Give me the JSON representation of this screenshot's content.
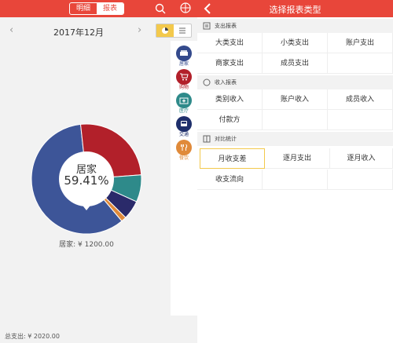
{
  "left": {
    "tabs": [
      {
        "label": "明细",
        "selected": false
      },
      {
        "label": "报表",
        "selected": true
      }
    ],
    "month": "2017年12月",
    "categories": [
      {
        "label": "居家",
        "color": "#344a8c",
        "icon": "sofa-icon"
      },
      {
        "label": "购物",
        "color": "#b2202a",
        "icon": "cart-icon"
      },
      {
        "label": "医疗",
        "color": "#2e8a8a",
        "icon": "medical-icon"
      },
      {
        "label": "交通",
        "color": "#1e2f6b",
        "icon": "bus-icon"
      },
      {
        "label": "餐饮",
        "color": "#e08a3a",
        "icon": "food-icon"
      }
    ],
    "pie_center": {
      "name": "居家",
      "percent": "59.41%"
    },
    "selected_amount": "居家: ¥ 1200.00",
    "total": "总支出: ¥ 2020.00"
  },
  "chart_data": {
    "type": "pie",
    "series": [
      {
        "name": "居家",
        "value": 59.41,
        "color": "#3d5598"
      },
      {
        "name": "购物",
        "value": 25.5,
        "color": "#b2202a"
      },
      {
        "name": "医疗",
        "value": 8.0,
        "color": "#2e8a8a"
      },
      {
        "name": "交通",
        "value": 5.6,
        "color": "#2a2a6a"
      },
      {
        "name": "餐饮",
        "value": 1.49,
        "color": "#e08a3a"
      }
    ]
  },
  "right": {
    "title": "选择报表类型",
    "sections": [
      {
        "title": "支出报表",
        "items": [
          "大类支出",
          "小类支出",
          "账户支出",
          "商家支出",
          "成员支出",
          ""
        ]
      },
      {
        "title": "收入报表",
        "items": [
          "类别收入",
          "账户收入",
          "成员收入",
          "付款方",
          "",
          ""
        ]
      },
      {
        "title": "对比统计",
        "items": [
          "月收支差",
          "逐月支出",
          "逐月收入",
          "收支流向",
          "",
          ""
        ]
      }
    ]
  }
}
